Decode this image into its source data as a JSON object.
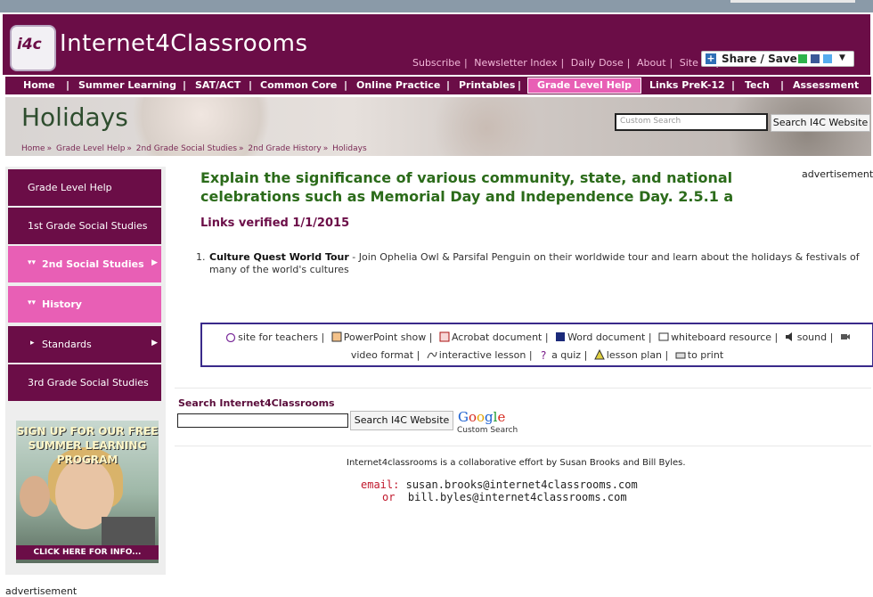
{
  "site": {
    "logo_badge": "i4c",
    "logo_text": "Internet4Classrooms",
    "top_links": [
      "Subscribe",
      "Newsletter Index",
      "Daily Dose",
      "About",
      "Site Map"
    ],
    "share_label": "Share / Save"
  },
  "nav": {
    "items": [
      "Home",
      "Summer Learning",
      "SAT/ACT",
      "Common Core",
      "Online Practice",
      "Printables",
      "Grade Level Help",
      "Links PreK-12",
      "Tech",
      "Assessment"
    ],
    "active": "Grade Level Help"
  },
  "banner": {
    "title": "Holidays",
    "breadcrumbs": [
      "Home",
      "Grade Level Help",
      "2nd Grade Social Studies",
      "2nd Grade History",
      "Holidays"
    ],
    "search_placeholder": "Custom Search",
    "search_button": "Search I4C Website"
  },
  "sidebar": {
    "items": [
      {
        "label": "Grade Level Help",
        "style": "dark"
      },
      {
        "label": "1st Grade Social Studies",
        "style": "dark"
      },
      {
        "label": "2nd Social Studies",
        "style": "pink"
      },
      {
        "label": "History",
        "style": "pink"
      },
      {
        "label": "Standards",
        "style": "dark"
      },
      {
        "label": "3rd Grade Social Studies",
        "style": "dark"
      }
    ],
    "promo_title": "SIGN UP FOR OUR FREE SUMMER LEARNING PROGRAM",
    "promo_cta": "CLICK HERE FOR INFO...",
    "advertisement": "advertisement"
  },
  "main": {
    "title": "Explain the significance of various community, state, and national celebrations such as Memorial Day and Independence Day. 2.5.1 a",
    "advertisement": "advertisement",
    "verified": "Links verified 1/1/2015",
    "links": [
      {
        "number": "1.",
        "title": "Culture Quest World Tour",
        "description": " - Join Ophelia Owl & Parsifal Penguin on their worldwide tour and learn about the holidays & festivals of many of the world's cultures"
      }
    ]
  },
  "legend": {
    "row1": [
      "site for teachers",
      "PowerPoint show",
      "Acrobat document",
      "Word document",
      "whiteboard resource",
      "sound"
    ],
    "row2": [
      "video format",
      "interactive lesson",
      "a quiz",
      "lesson plan",
      "to print"
    ]
  },
  "search_block": {
    "label": "Search Internet4Classrooms",
    "button": "Search I4C Website",
    "google_sub": "Custom Search"
  },
  "footer": {
    "collab": "Internet4classrooms is a collaborative effort by Susan Brooks and Bill Byles.",
    "email_label": "email:",
    "email_1": "susan.brooks@internet4classrooms.com",
    "or_label": "or",
    "email_2": "bill.byles@internet4classrooms.com"
  }
}
